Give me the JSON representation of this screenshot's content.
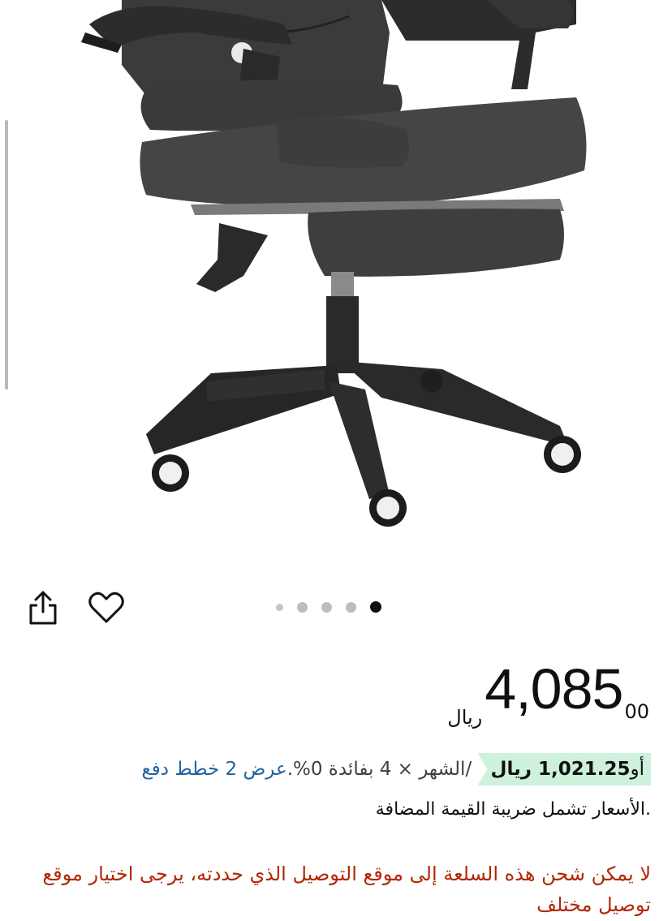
{
  "product": {
    "image_alt": "Black reclining office chair with footrest",
    "carousel": {
      "total": 5,
      "active_index": 4
    }
  },
  "actions": {
    "share_icon": "share-icon",
    "wishlist_icon": "heart-outline-icon"
  },
  "price": {
    "currency": "ريال",
    "whole": "4,085",
    "fraction": "00"
  },
  "installment": {
    "or_prefix": "أو",
    "monthly_amount": "1,021.25 ريال",
    "per_month_text": "/الشهر × 4 بفائدة 0%.",
    "offer_link": "عرض 2 خطط دفع"
  },
  "vat_note": ".الأسعار تشمل ضريبة القيمة المضافة",
  "shipping_warning": "لا يمكن شحن هذه السلعة إلى موقع التوصيل الذي حددته، يرجى اختيار موقع توصيل مختلف",
  "colors": {
    "accent_green": "#cef1dc",
    "link_blue": "#2162a1",
    "warning_red": "#b12704"
  }
}
